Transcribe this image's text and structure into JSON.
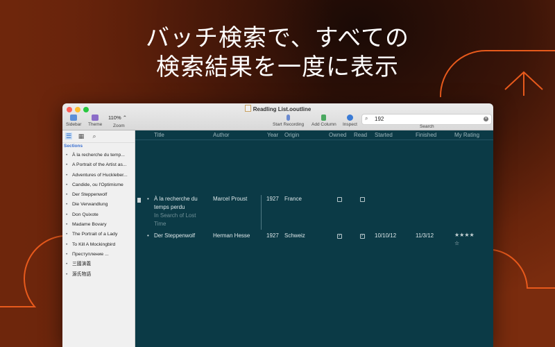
{
  "headline": {
    "line1": "バッチ検索で、すべての",
    "line2": "検索結果を一度に表示"
  },
  "window": {
    "title": "Readling List.ooutline",
    "toolbar": {
      "sidebar_label": "Sidebar",
      "theme_label": "Theme",
      "zoom_value": "110% ⌃",
      "zoom_label": "Zoom",
      "start_recording_label": "Start Recording",
      "add_column_label": "Add Column",
      "inspect_label": "Inspect",
      "search_value": "192",
      "search_label": "Search"
    },
    "sidebar": {
      "section_label": "Sections",
      "items": [
        "À la recherche du temp...",
        "A Portrait of the Artist as...",
        "Adventures of Huckleber...",
        "Candide, ou l'Optimisme",
        "Der Steppenwolf",
        "Die Verwandlung",
        "Don Quixote",
        "Madame Bovary",
        "The Portrait of a Lady",
        "To Kill A Mockingbird",
        "Преступление ...",
        "三國演義",
        "源氏物語"
      ]
    },
    "columns": [
      "Title",
      "Author",
      "Year",
      "Origin",
      "Owned",
      "Read",
      "Started",
      "Finished",
      "My Rating"
    ],
    "rows": [
      {
        "title_line1": "À la recherche du",
        "title_line2": "temps perdu",
        "note_line1": "In Search of Lost",
        "note_line2": "Time",
        "author": "Marcel Proust",
        "year": "1927",
        "origin": "France",
        "owned": "☐",
        "read": "☐",
        "started": "",
        "finished": "",
        "rating": ""
      },
      {
        "title_line1": "Der Steppenwolf",
        "author": "Herman Hesse",
        "year": "1927",
        "origin": "Schweiz",
        "owned": "✓",
        "read": "✓",
        "started": "10/10/12",
        "finished": "11/3/12",
        "rating_line1": "★★★★",
        "rating_line2": "☆"
      }
    ]
  },
  "colors": {
    "accent_orange": "#e85a1c",
    "outline_bg": "#0b3a46",
    "sidebar_bg": "#f0f0f0",
    "section_blue": "#3a6fd0"
  }
}
